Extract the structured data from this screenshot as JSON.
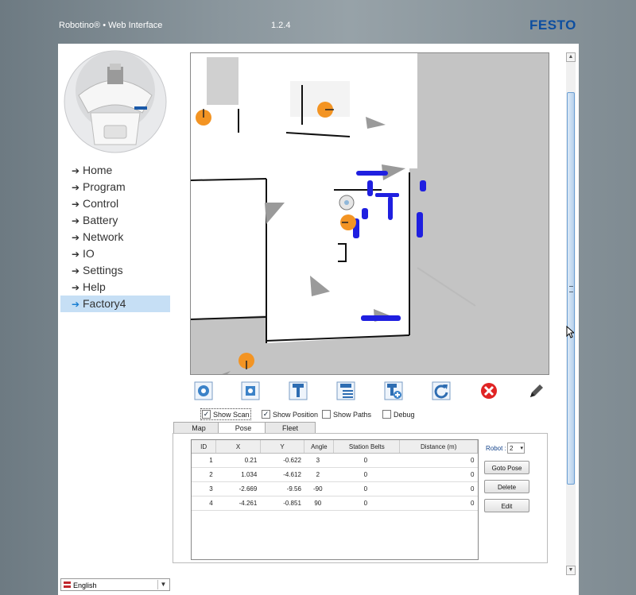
{
  "header": {
    "title": "Robotino® • Web Interface",
    "version": "1.2.4",
    "brand": "FESTO"
  },
  "nav": {
    "items": [
      {
        "label": "Home"
      },
      {
        "label": "Program"
      },
      {
        "label": "Control"
      },
      {
        "label": "Battery"
      },
      {
        "label": "Network"
      },
      {
        "label": "IO"
      },
      {
        "label": "Settings"
      },
      {
        "label": "Help"
      },
      {
        "label": "Factory4",
        "active": true
      }
    ]
  },
  "language": {
    "selected": "English"
  },
  "toolbar": {
    "icons": [
      "add-pose-icon",
      "set-pose-icon",
      "station-icon",
      "station-list-icon",
      "add-station-icon",
      "rotate-icon",
      "delete-icon",
      "pen-icon"
    ]
  },
  "options": {
    "show_scan": "Show Scan",
    "show_position": "Show Position",
    "show_paths": "Show Paths",
    "debug": "Debug"
  },
  "tabs": {
    "map": "Map",
    "pose": "Pose",
    "fleet": "Fleet"
  },
  "pose_table": {
    "columns": [
      "ID",
      "X",
      "Y",
      "Angle",
      "Station Belts",
      "Distance (m)"
    ],
    "rows": [
      [
        "1",
        "0.21",
        "-0.622",
        "3",
        "0",
        "0"
      ],
      [
        "2",
        "1.034",
        "-4.612",
        "2",
        "0",
        "0"
      ],
      [
        "3",
        "-2.669",
        "-9.56",
        "-90",
        "0",
        "0"
      ],
      [
        "4",
        "-4.261",
        "-0.851",
        "90",
        "0",
        "0"
      ]
    ]
  },
  "robot_select": {
    "label": "Robot :",
    "value": "2"
  },
  "buttons": {
    "goto": "Goto Pose",
    "delete": "Delete",
    "edit": "Edit"
  },
  "colors": {
    "accent": "#1a7fd2",
    "brand": "#0d4ea0",
    "scan": "#1f1fe0",
    "pose_marker": "#f39423"
  }
}
